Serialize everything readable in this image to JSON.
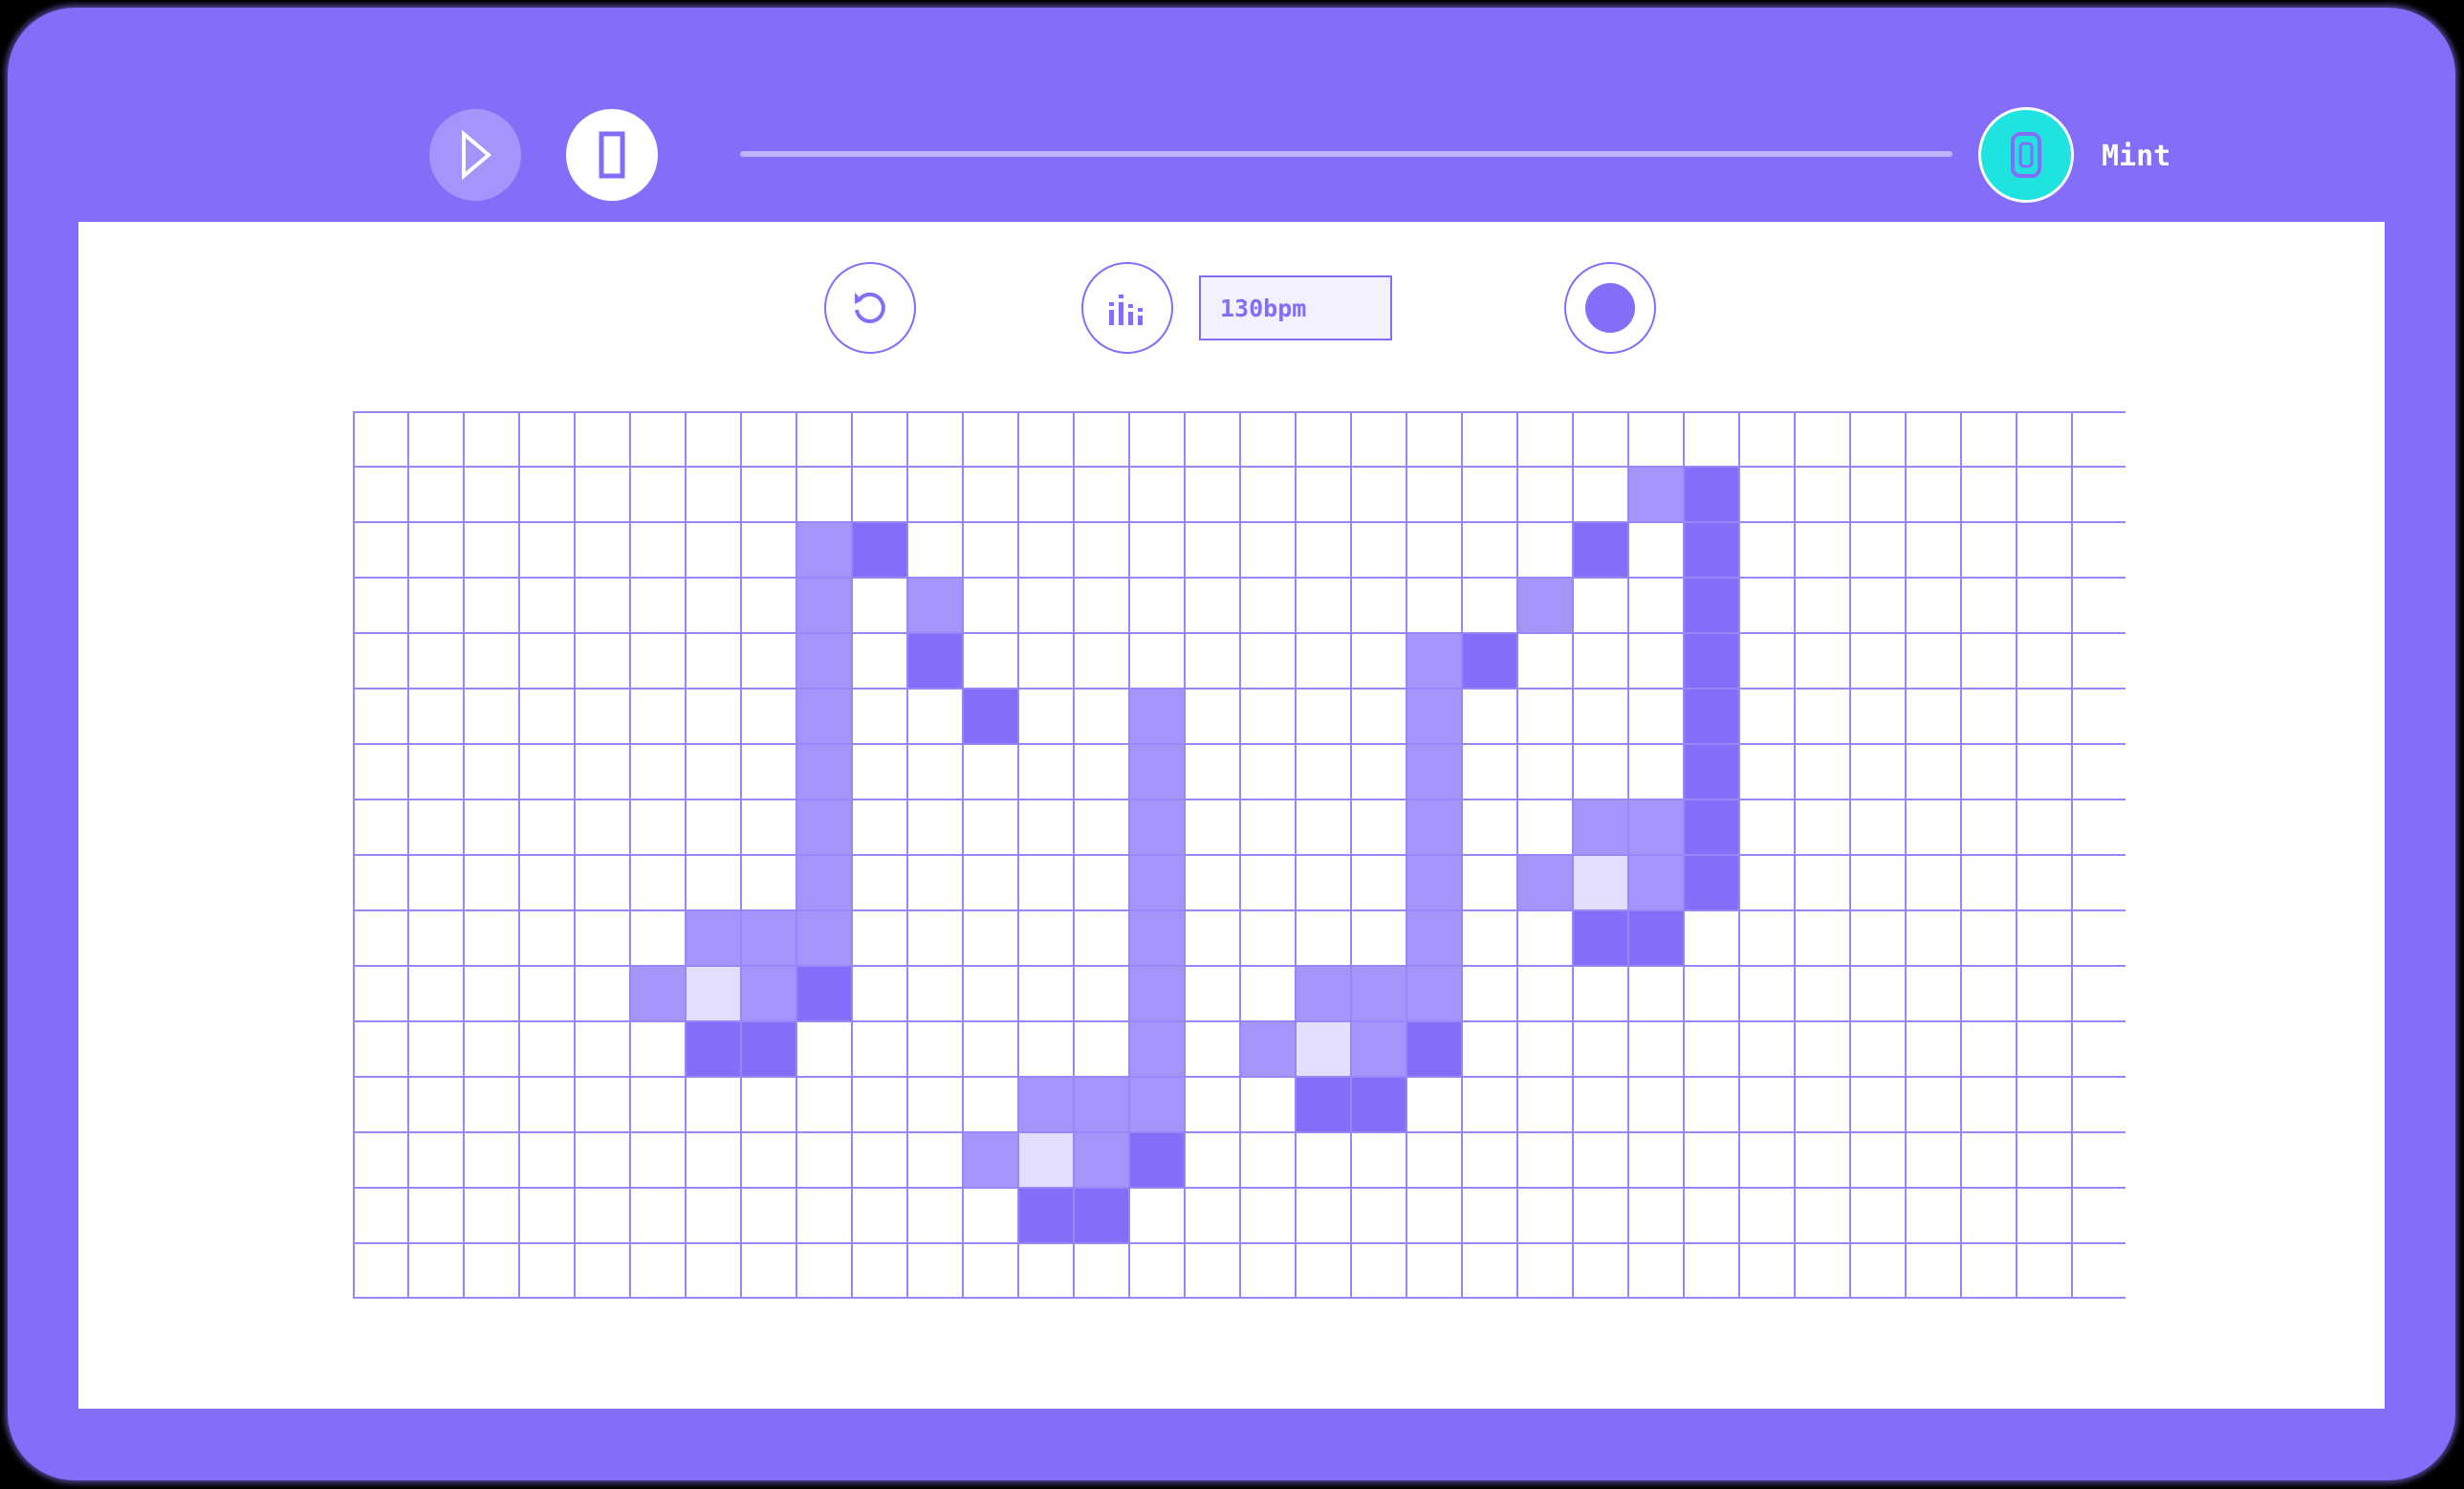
{
  "toolbar": {
    "play_icon": "play-icon",
    "doc_icon": "document-icon",
    "account_icon": "wallet-icon",
    "mint_label": "Mint"
  },
  "controls": {
    "reset_icon": "reset-icon",
    "tempo_icon": "equalizer-icon",
    "tempo_value": "130bpm",
    "record_icon": "record-icon"
  },
  "colors": {
    "brand": "#846df9",
    "light": "#a794fb",
    "pale": "#e3defc",
    "accent": "#1ee3df",
    "grid_line": "#9a86fa"
  },
  "sequencer": {
    "columns": 32,
    "rows": 16,
    "cells": [
      {
        "c": 8,
        "r": 2,
        "s": "l"
      },
      {
        "c": 9,
        "r": 2,
        "s": "d"
      },
      {
        "c": 8,
        "r": 3,
        "s": "l"
      },
      {
        "c": 10,
        "r": 3,
        "s": "l"
      },
      {
        "c": 8,
        "r": 4,
        "s": "l"
      },
      {
        "c": 10,
        "r": 4,
        "s": "d"
      },
      {
        "c": 8,
        "r": 5,
        "s": "l"
      },
      {
        "c": 11,
        "r": 5,
        "s": "d"
      },
      {
        "c": 8,
        "r": 6,
        "s": "l"
      },
      {
        "c": 8,
        "r": 7,
        "s": "l"
      },
      {
        "c": 8,
        "r": 8,
        "s": "l"
      },
      {
        "c": 6,
        "r": 9,
        "s": "l"
      },
      {
        "c": 7,
        "r": 9,
        "s": "l"
      },
      {
        "c": 8,
        "r": 9,
        "s": "l"
      },
      {
        "c": 5,
        "r": 10,
        "s": "l"
      },
      {
        "c": 6,
        "r": 10,
        "s": "p"
      },
      {
        "c": 7,
        "r": 10,
        "s": "l"
      },
      {
        "c": 8,
        "r": 10,
        "s": "d"
      },
      {
        "c": 6,
        "r": 11,
        "s": "d"
      },
      {
        "c": 7,
        "r": 11,
        "s": "d"
      },
      {
        "c": 14,
        "r": 5,
        "s": "l"
      },
      {
        "c": 14,
        "r": 6,
        "s": "l"
      },
      {
        "c": 14,
        "r": 7,
        "s": "l"
      },
      {
        "c": 14,
        "r": 8,
        "s": "l"
      },
      {
        "c": 14,
        "r": 9,
        "s": "l"
      },
      {
        "c": 14,
        "r": 10,
        "s": "l"
      },
      {
        "c": 14,
        "r": 11,
        "s": "l"
      },
      {
        "c": 12,
        "r": 12,
        "s": "l"
      },
      {
        "c": 13,
        "r": 12,
        "s": "l"
      },
      {
        "c": 14,
        "r": 12,
        "s": "l"
      },
      {
        "c": 11,
        "r": 13,
        "s": "l"
      },
      {
        "c": 12,
        "r": 13,
        "s": "p"
      },
      {
        "c": 13,
        "r": 13,
        "s": "l"
      },
      {
        "c": 14,
        "r": 13,
        "s": "d"
      },
      {
        "c": 12,
        "r": 14,
        "s": "d"
      },
      {
        "c": 13,
        "r": 14,
        "s": "d"
      },
      {
        "c": 19,
        "r": 4,
        "s": "l"
      },
      {
        "c": 20,
        "r": 4,
        "s": "d"
      },
      {
        "c": 19,
        "r": 5,
        "s": "l"
      },
      {
        "c": 19,
        "r": 6,
        "s": "l"
      },
      {
        "c": 19,
        "r": 7,
        "s": "l"
      },
      {
        "c": 19,
        "r": 8,
        "s": "l"
      },
      {
        "c": 19,
        "r": 9,
        "s": "l"
      },
      {
        "c": 17,
        "r": 10,
        "s": "l"
      },
      {
        "c": 18,
        "r": 10,
        "s": "l"
      },
      {
        "c": 19,
        "r": 10,
        "s": "l"
      },
      {
        "c": 16,
        "r": 11,
        "s": "l"
      },
      {
        "c": 17,
        "r": 11,
        "s": "p"
      },
      {
        "c": 18,
        "r": 11,
        "s": "l"
      },
      {
        "c": 19,
        "r": 11,
        "s": "d"
      },
      {
        "c": 17,
        "r": 12,
        "s": "d"
      },
      {
        "c": 18,
        "r": 12,
        "s": "d"
      },
      {
        "c": 23,
        "r": 1,
        "s": "l"
      },
      {
        "c": 24,
        "r": 1,
        "s": "d"
      },
      {
        "c": 22,
        "r": 2,
        "s": "d"
      },
      {
        "c": 24,
        "r": 2,
        "s": "d"
      },
      {
        "c": 21,
        "r": 3,
        "s": "l"
      },
      {
        "c": 24,
        "r": 3,
        "s": "d"
      },
      {
        "c": 24,
        "r": 4,
        "s": "d"
      },
      {
        "c": 24,
        "r": 5,
        "s": "d"
      },
      {
        "c": 24,
        "r": 6,
        "s": "d"
      },
      {
        "c": 22,
        "r": 7,
        "s": "l"
      },
      {
        "c": 23,
        "r": 7,
        "s": "l"
      },
      {
        "c": 24,
        "r": 7,
        "s": "d"
      },
      {
        "c": 21,
        "r": 8,
        "s": "l"
      },
      {
        "c": 22,
        "r": 8,
        "s": "p"
      },
      {
        "c": 23,
        "r": 8,
        "s": "l"
      },
      {
        "c": 24,
        "r": 8,
        "s": "d"
      },
      {
        "c": 22,
        "r": 9,
        "s": "d"
      },
      {
        "c": 23,
        "r": 9,
        "s": "d"
      }
    ]
  }
}
